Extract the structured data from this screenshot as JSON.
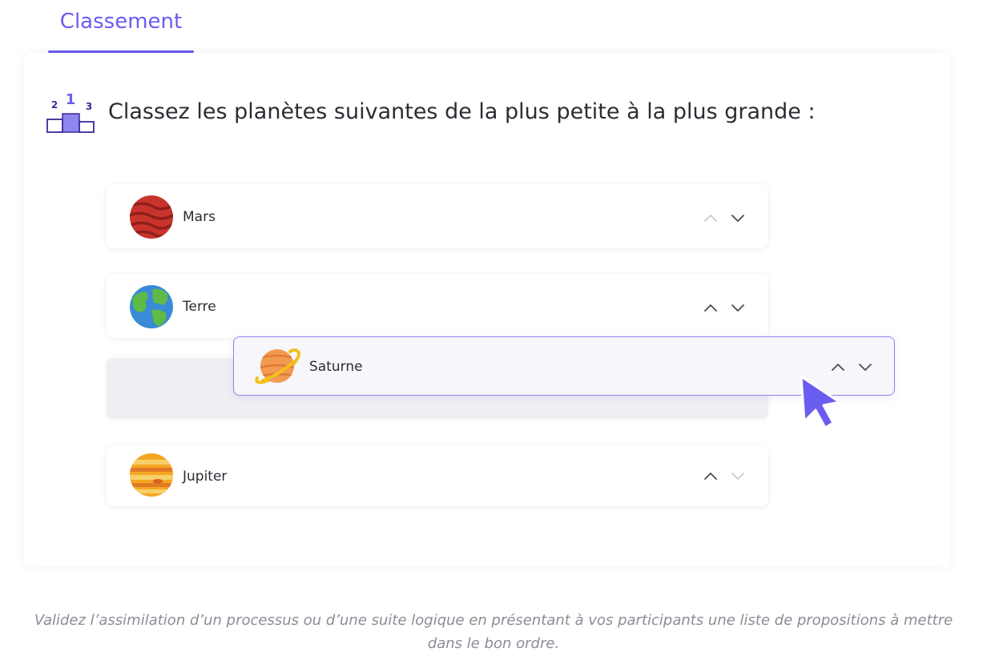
{
  "tab": {
    "label": "Classement"
  },
  "question": {
    "text": "Classez les planètes suivantes de la plus petite à la plus grande :"
  },
  "podium": {
    "first": "1",
    "second": "2",
    "third": "3"
  },
  "items": [
    {
      "label": "Mars",
      "icon": "mars-planet-icon"
    },
    {
      "label": "Terre",
      "icon": "earth-planet-icon"
    },
    {
      "label": "Saturne",
      "icon": "saturn-planet-icon",
      "state": "dragging"
    },
    {
      "label": "Jupiter",
      "icon": "jupiter-planet-icon"
    }
  ],
  "footer": {
    "text": "Validez l’assimilation d’un processus ou d’une suite logique en présentant à vos participants une liste de propositions à mettre dans le bon ordre."
  },
  "colors": {
    "accent": "#6b5cf0",
    "text": "#2b2d33",
    "muted": "#8b8d95",
    "drag_border": "#8f85ee"
  }
}
